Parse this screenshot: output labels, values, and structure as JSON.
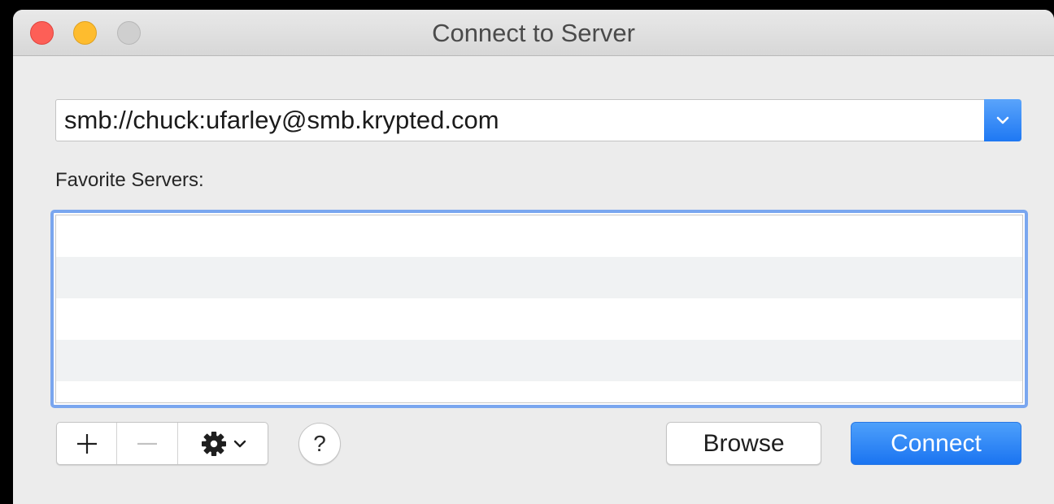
{
  "window": {
    "title": "Connect to Server"
  },
  "server_address": {
    "value": "smb://chuck:ufarley@smb.krypted.com"
  },
  "favorites": {
    "label": "Favorite Servers:",
    "rows": [
      "",
      "",
      "",
      "",
      ""
    ]
  },
  "toolbar": {
    "help_label": "?",
    "browse_label": "Browse",
    "connect_label": "Connect"
  },
  "colors": {
    "accent": "#1e78f3",
    "close": "#fd5f57",
    "minimize": "#febc2e",
    "zoom_disabled": "#cfcfcf"
  },
  "icons": {
    "add": "plus-icon",
    "remove": "minus-icon",
    "action": "gear-icon",
    "dropdown": "chevron-down-icon"
  }
}
